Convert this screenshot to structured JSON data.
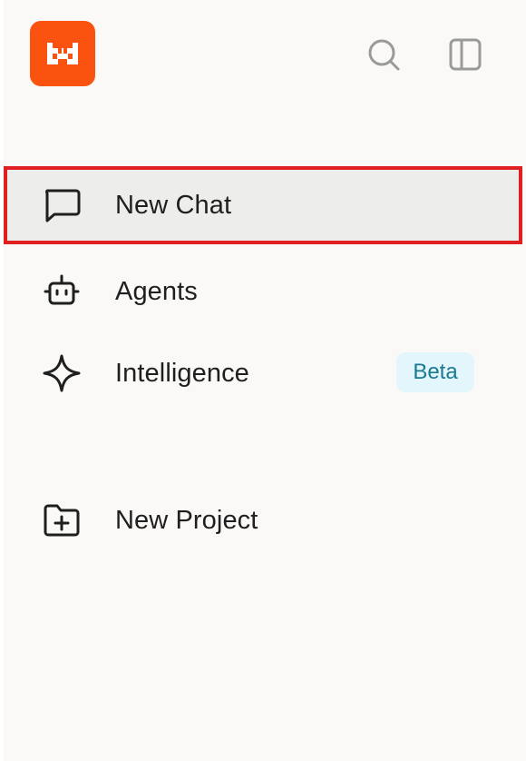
{
  "brand": {
    "logo_icon": "pixel-creature-logo-icon",
    "logo_bg": "#fa520f",
    "logo_fg": "#ffffff"
  },
  "header": {
    "search_icon": "search-icon",
    "sidebar_toggle_icon": "sidebar-toggle-icon"
  },
  "nav": {
    "items": [
      {
        "label": "New Chat",
        "icon": "chat-bubble-icon",
        "active": true
      },
      {
        "label": "Agents",
        "icon": "robot-icon",
        "active": false
      },
      {
        "label": "Intelligence",
        "icon": "sparkle-icon",
        "active": false,
        "badge": "Beta"
      },
      {
        "label": "New Project",
        "icon": "folder-plus-icon",
        "active": false
      }
    ]
  },
  "colors": {
    "sidebar_bg": "#faf9f7",
    "active_bg": "#ededeb",
    "highlight_border": "#e02020",
    "icon_muted": "#9a9a9a",
    "badge_bg": "#e3f6fb",
    "badge_text": "#1a7a93",
    "text": "#1f1f1f"
  }
}
